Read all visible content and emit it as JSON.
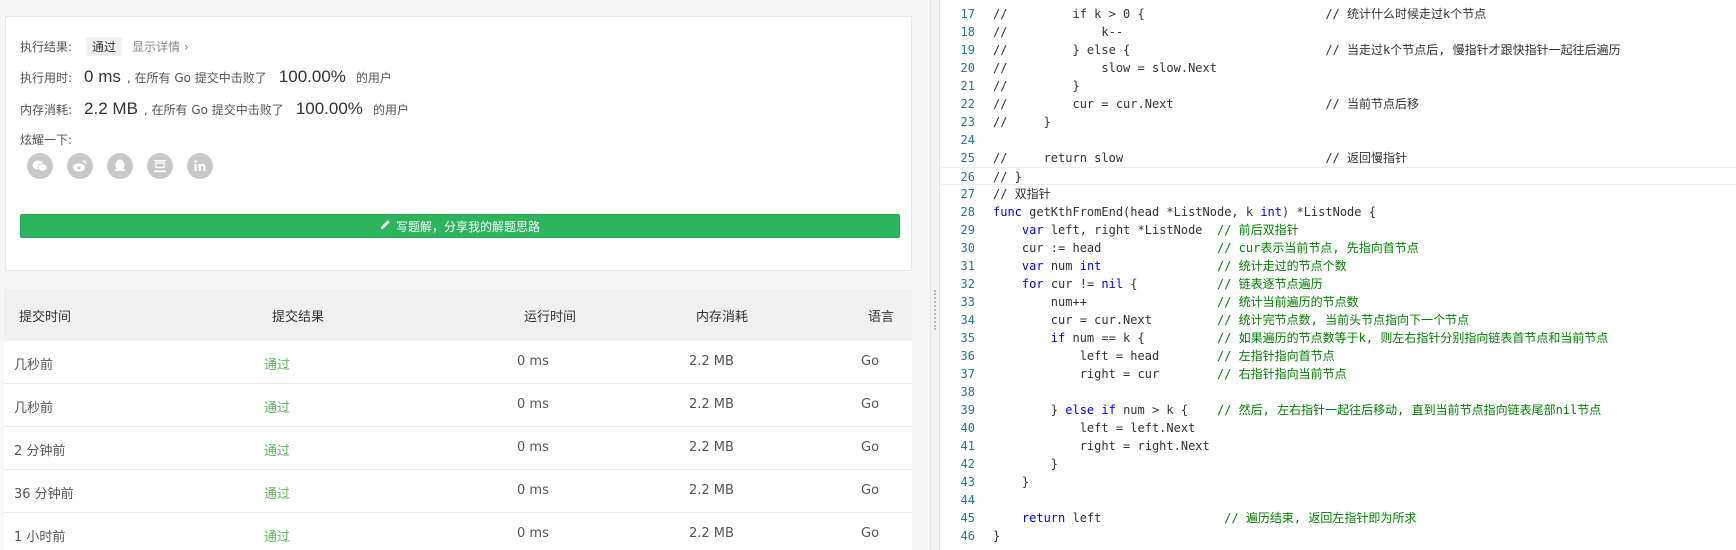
{
  "result": {
    "status_label": "执行结果:",
    "status_badge": "通过",
    "details_link": "显示详情 ›",
    "runtime_label": "执行用时:",
    "runtime_value": "0 ms",
    "runtime_beat_text": ", 在所有 Go 提交中击败了",
    "runtime_percent": "100.00%",
    "runtime_users": "的用户",
    "memory_label": "内存消耗:",
    "memory_value": "2.2 MB",
    "memory_beat_text": ", 在所有 Go 提交中击败了",
    "memory_percent": "100.00%",
    "memory_users": "的用户",
    "share_label": "炫耀一下:",
    "share_icons": [
      "wechat-icon",
      "weibo-icon",
      "qq-icon",
      "douban-icon",
      "linkedin-icon"
    ],
    "write_button": "写题解，分享我的解题思路"
  },
  "submissions": {
    "headers": [
      "提交时间",
      "提交结果",
      "运行时间",
      "内存消耗",
      "语言"
    ],
    "rows": [
      {
        "time": "几秒前",
        "result": "通过",
        "runtime": "0 ms",
        "memory": "2.2 MB",
        "lang": "Go"
      },
      {
        "time": "几秒前",
        "result": "通过",
        "runtime": "0 ms",
        "memory": "2.2 MB",
        "lang": "Go"
      },
      {
        "time": "2 分钟前",
        "result": "通过",
        "runtime": "0 ms",
        "memory": "2.2 MB",
        "lang": "Go"
      },
      {
        "time": "36 分钟前",
        "result": "通过",
        "runtime": "0 ms",
        "memory": "2.2 MB",
        "lang": "Go"
      },
      {
        "time": "1 小时前",
        "result": "通过",
        "runtime": "0 ms",
        "memory": "2.2 MB",
        "lang": "Go"
      }
    ]
  },
  "colors": {
    "accent_green": "#2db55d",
    "pass_green": "#5cb85c",
    "comment": "#008000",
    "keyword": "#0000ff",
    "line_number": "#237893"
  },
  "code_lines": [
    {
      "n": "17",
      "text": "//         if k > 0 {                         // 统计什么时候走过k个节点",
      "cls": "cm"
    },
    {
      "n": "18",
      "text": "//             k--",
      "cls": "cm"
    },
    {
      "n": "19",
      "text": "//         } else {                           // 当走过k个节点后, 慢指针才跟快指针一起往后遍历",
      "cls": "cm"
    },
    {
      "n": "20",
      "text": "//             slow = slow.Next",
      "cls": "cm"
    },
    {
      "n": "21",
      "text": "//         }",
      "cls": "cm"
    },
    {
      "n": "22",
      "text": "//         cur = cur.Next                     // 当前节点后移",
      "cls": "cm"
    },
    {
      "n": "23",
      "text": "//     }",
      "cls": "cm"
    },
    {
      "n": "24",
      "text": "",
      "cls": ""
    },
    {
      "n": "25",
      "text": "//     return slow                            // 返回慢指针",
      "cls": "cm"
    },
    {
      "n": "26",
      "text": "// }",
      "cls": "cm",
      "active": true
    },
    {
      "n": "27",
      "text": "// 双指针",
      "cls": "cm"
    },
    {
      "n": "28",
      "text": "func getKthFromEnd(head *ListNode, k int) *ListNode {",
      "cls": "kw-line"
    },
    {
      "n": "29",
      "text": "    var left, right *ListNode  // 前后双指针",
      "cls": "mix"
    },
    {
      "n": "30",
      "text": "    cur := head                // cur表示当前节点, 先指向首节点",
      "cls": "mix"
    },
    {
      "n": "31",
      "text": "    var num int                // 统计走过的节点个数",
      "cls": "mix"
    },
    {
      "n": "32",
      "text": "    for cur != nil {           // 链表逐节点遍历",
      "cls": "mix"
    },
    {
      "n": "33",
      "text": "        num++                  // 统计当前遍历的节点数",
      "cls": "mix"
    },
    {
      "n": "34",
      "text": "        cur = cur.Next         // 统计完节点数, 当前头节点指向下一个节点",
      "cls": "mix"
    },
    {
      "n": "35",
      "text": "        if num == k {          // 如果遍历的节点数等于k, 则左右指针分别指向链表首节点和当前节点",
      "cls": "mix"
    },
    {
      "n": "36",
      "text": "            left = head        // 左指针指向首节点",
      "cls": "mix"
    },
    {
      "n": "37",
      "text": "            right = cur        // 右指针指向当前节点",
      "cls": "mix"
    },
    {
      "n": "38",
      "text": "",
      "cls": ""
    },
    {
      "n": "39",
      "text": "        } else if num > k {    // 然后, 左右指针一起往后移动, 直到当前节点指向链表尾部nil节点",
      "cls": "mix"
    },
    {
      "n": "40",
      "text": "            left = left.Next",
      "cls": "mix"
    },
    {
      "n": "41",
      "text": "            right = right.Next",
      "cls": "mix"
    },
    {
      "n": "42",
      "text": "        }",
      "cls": "mix"
    },
    {
      "n": "43",
      "text": "    }",
      "cls": "mix"
    },
    {
      "n": "44",
      "text": "",
      "cls": ""
    },
    {
      "n": "45",
      "text": "    return left                 // 遍历结束, 返回左指针即为所求",
      "cls": "mix"
    },
    {
      "n": "46",
      "text": "}",
      "cls": "mix"
    }
  ]
}
